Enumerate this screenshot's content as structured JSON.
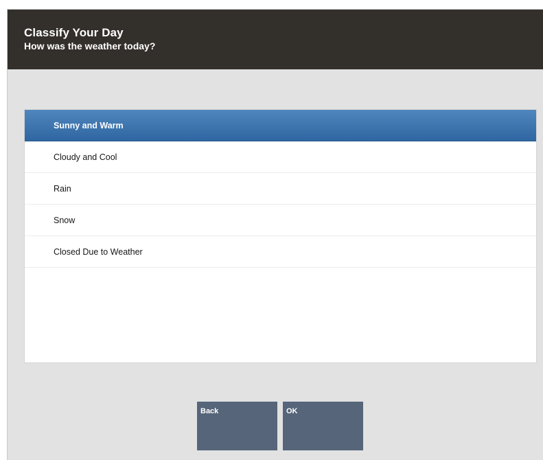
{
  "header": {
    "title": "Classify Your Day",
    "subtitle": "How was the weather today?"
  },
  "options": [
    {
      "label": "Sunny and Warm",
      "selected": true
    },
    {
      "label": "Cloudy and Cool",
      "selected": false
    },
    {
      "label": "Rain",
      "selected": false
    },
    {
      "label": "Snow",
      "selected": false
    },
    {
      "label": "Closed Due to Weather",
      "selected": false
    }
  ],
  "buttons": {
    "back_label": "Back",
    "ok_label": "OK"
  },
  "colors": {
    "header_bg": "#332f2b",
    "selection": "#3a72ab",
    "button_bg": "#566579",
    "background": "#e2e2e2"
  }
}
